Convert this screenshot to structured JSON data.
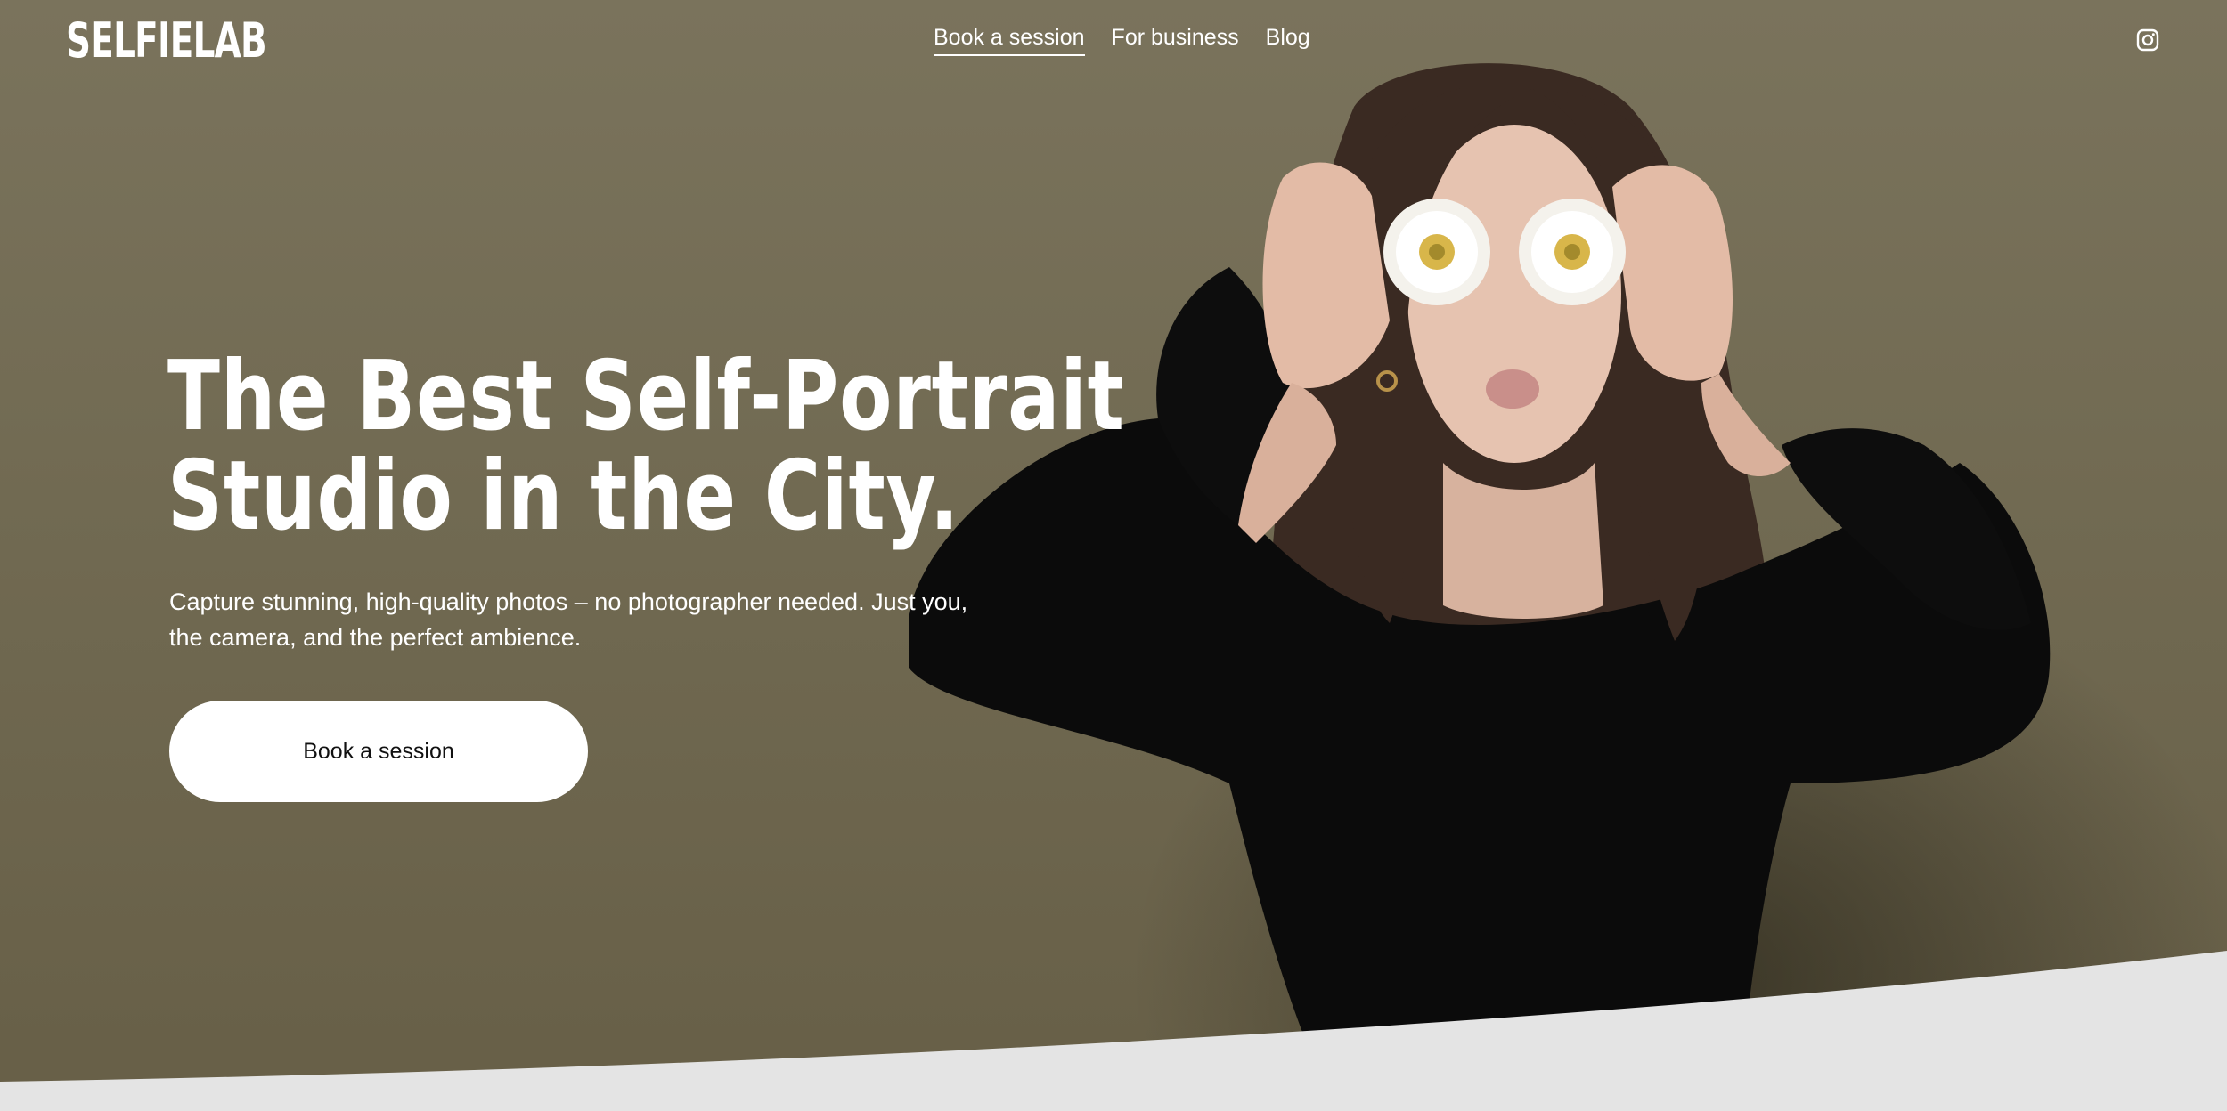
{
  "header": {
    "logo": "SELFIELAB",
    "nav": [
      {
        "label": "Book a session",
        "active": true
      },
      {
        "label": "For business",
        "active": false
      },
      {
        "label": "Blog",
        "active": false
      }
    ],
    "social_icon": "instagram-icon"
  },
  "hero": {
    "headline_line1": "The Best Self-Portrait",
    "headline_line2": "Studio in the City.",
    "subtext_line1": "Capture stunning, high-quality photos – no photographer needed. Just you,",
    "subtext_line2": "the camera, and the perfect ambience.",
    "cta_label": "Book a session"
  },
  "colors": {
    "background": "#736c54",
    "text": "#ffffff",
    "button": "#ffffff",
    "wave": "#e4e4e4"
  }
}
